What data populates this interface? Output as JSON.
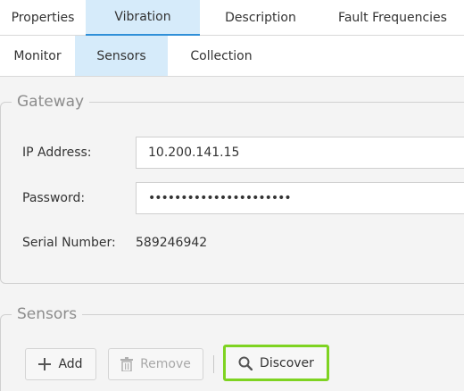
{
  "tabs_top": [
    {
      "label": "Properties"
    },
    {
      "label": "Vibration"
    },
    {
      "label": "Description"
    },
    {
      "label": "Fault Frequencies"
    }
  ],
  "tabs_sub": [
    {
      "label": "Monitor"
    },
    {
      "label": "Sensors"
    },
    {
      "label": "Collection"
    }
  ],
  "gateway": {
    "legend": "Gateway",
    "ip_label": "IP Address:",
    "ip_value": "10.200.141.15",
    "password_label": "Password:",
    "password_value": "••••••••••••••••••••••",
    "serial_label": "Serial Number:",
    "serial_value": "589246942"
  },
  "sensors": {
    "legend": "Sensors",
    "add_label": "Add",
    "remove_label": "Remove",
    "discover_label": "Discover"
  },
  "colors": {
    "active_tab_bg": "#d6ebfa",
    "active_tab_underline": "#2f8fd8",
    "highlight_border": "#7ed321"
  },
  "icons": {
    "add": "plus-icon",
    "remove": "trash-icon",
    "discover": "search-icon"
  }
}
